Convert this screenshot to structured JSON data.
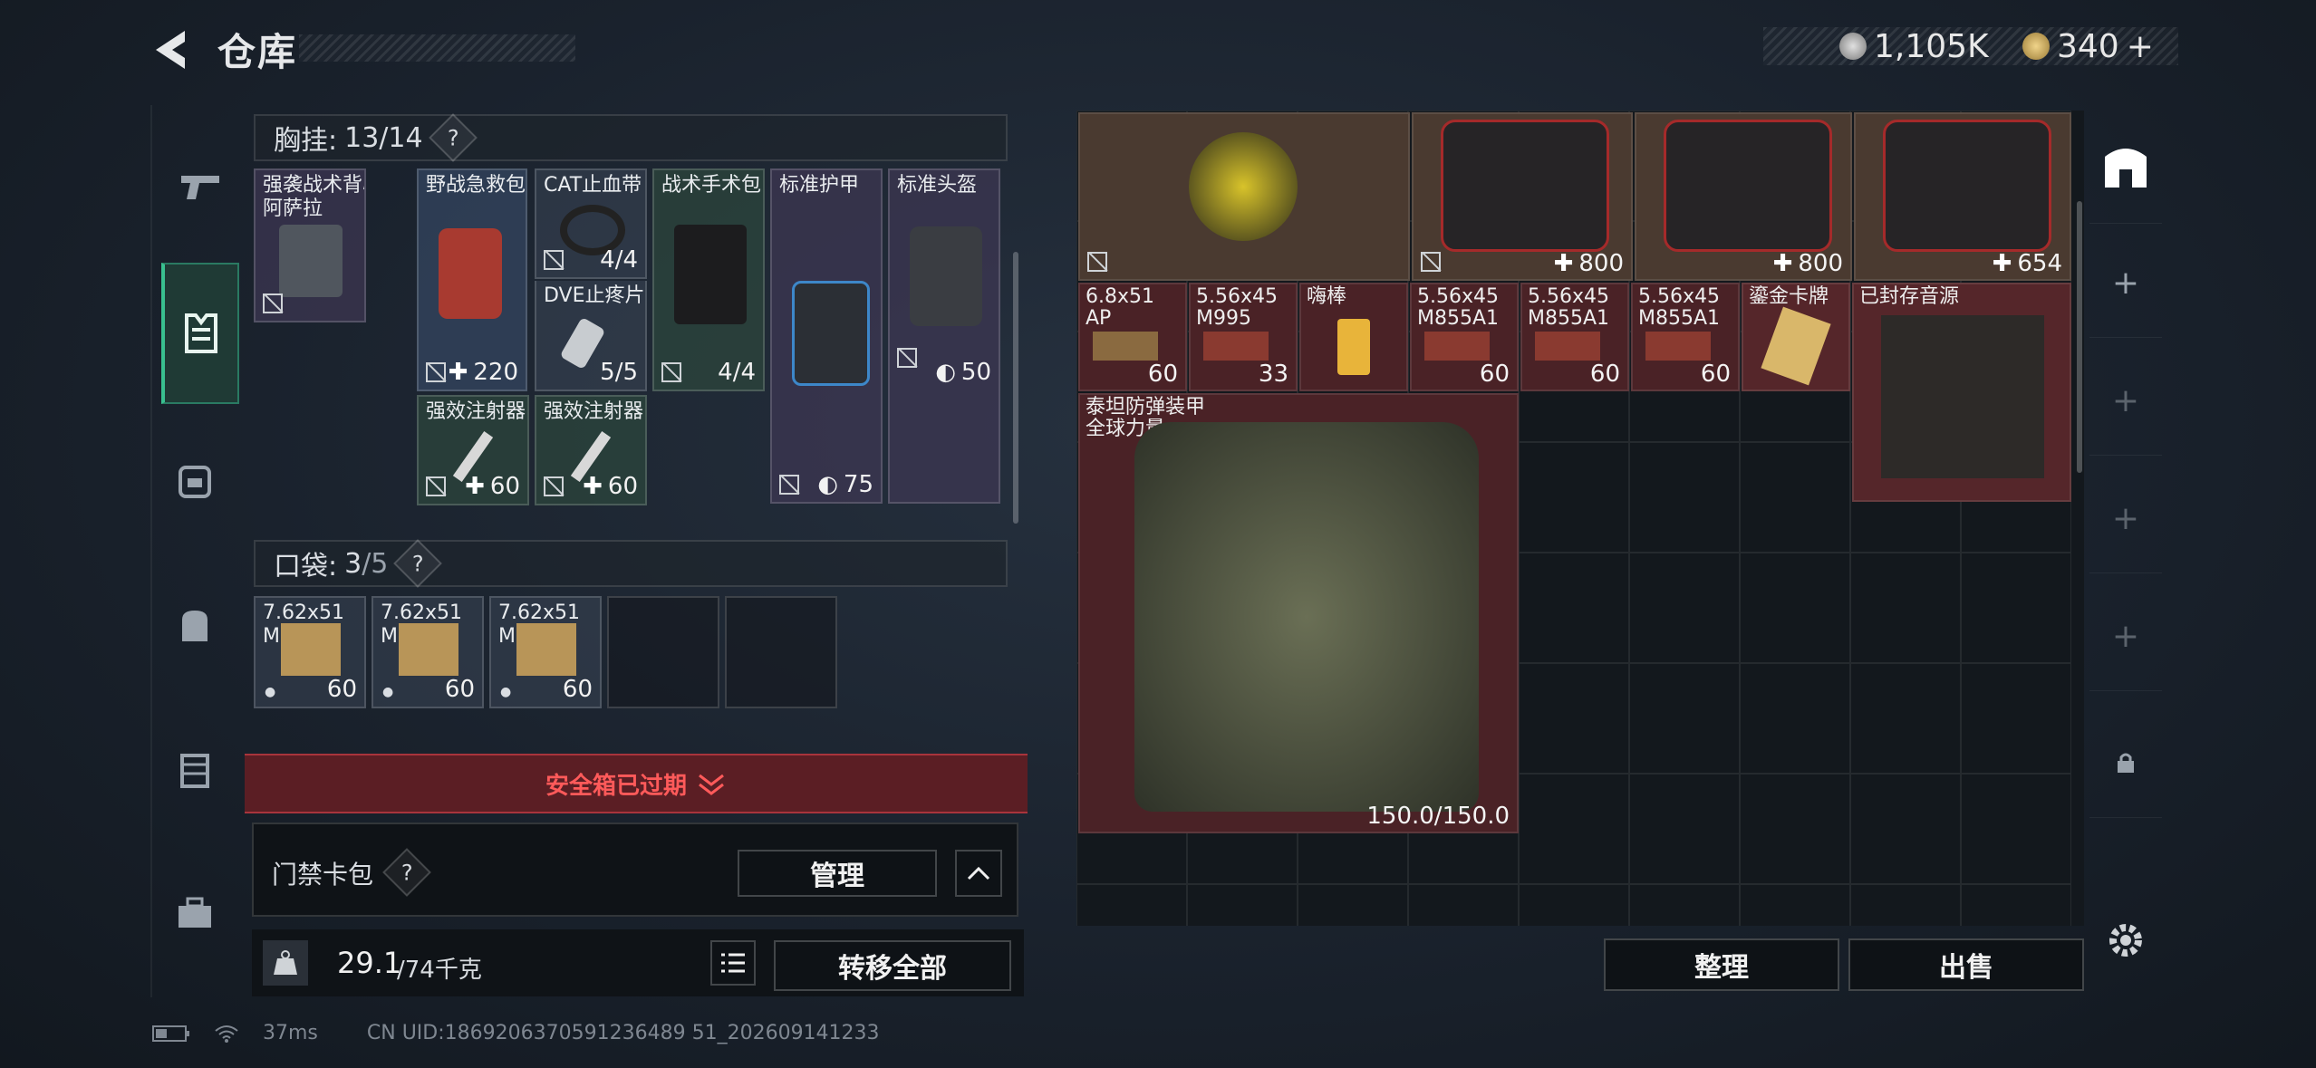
{
  "header": {
    "title": "仓库"
  },
  "currency": {
    "silver": "1,105K",
    "gold": "340",
    "gold_plus": "+"
  },
  "left": {
    "chest": {
      "label": "胸挂:",
      "count": "13/14",
      "help": "?"
    },
    "chest_items": [
      {
        "name": "强袭战术背心\n阿萨拉",
        "count": ""
      },
      {
        "name": "野战急救包",
        "count": "220"
      },
      {
        "name": "CAT止血带",
        "count": "4/4"
      },
      {
        "name": "DVE止疼片",
        "count": "5/5"
      },
      {
        "name": "战术手术包",
        "count": "4/4"
      },
      {
        "name": "标准护甲",
        "count": "75"
      },
      {
        "name": "标准头盔",
        "count": "50"
      },
      {
        "name": "强效注射器",
        "count": "60"
      },
      {
        "name": "强效注射器",
        "count": "60"
      }
    ],
    "pocket": {
      "label": "口袋:",
      "count": "3",
      "total": "/5",
      "help": "?"
    },
    "pocket_items": [
      {
        "name": "7.62x51\nM80",
        "count": "60"
      },
      {
        "name": "7.62x51\nM80",
        "count": "60"
      },
      {
        "name": "7.62x51\nM80",
        "count": "60"
      }
    ],
    "safebox_status": "安全箱已过期",
    "keycard": {
      "label": "门禁卡包",
      "help": "?",
      "manage": "管理"
    },
    "weight": {
      "value": "29.1",
      "max": "/74千克",
      "transfer_all": "转移全部"
    }
  },
  "stash_items": [
    {
      "name": "",
      "count": ""
    },
    {
      "name": "",
      "count": "800"
    },
    {
      "name": "",
      "count": "800"
    },
    {
      "name": "",
      "count": "654"
    },
    {
      "name": "6.8x51\nAP",
      "count": "60"
    },
    {
      "name": "5.56x45\nM995",
      "count": "33"
    },
    {
      "name": "嗨棒",
      "count": ""
    },
    {
      "name": "5.56x45\nM855A1",
      "count": "60"
    },
    {
      "name": "5.56x45\nM855A1",
      "count": "60"
    },
    {
      "name": "5.56x45\nM855A1",
      "count": "60"
    },
    {
      "name": "鎏金卡牌",
      "count": ""
    },
    {
      "name": "已封存音源",
      "count": ""
    },
    {
      "name": "泰坦防弹装甲\n全球力量",
      "count": "150.0/150.0"
    }
  ],
  "actions": {
    "organize": "整理",
    "sell": "出售"
  },
  "status": {
    "ping": "37ms",
    "uid": "CN UID:1869206370591236489 51_202609141233"
  },
  "colors": {
    "accent": "#39c08f",
    "danger": "#ff5a5a",
    "item_red": "#4a2226"
  }
}
